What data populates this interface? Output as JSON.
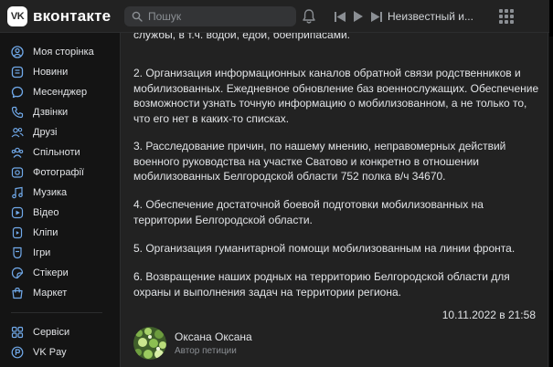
{
  "header": {
    "logo_badge": "VK",
    "logo_text": "вконтакте",
    "search_placeholder": "Пошук",
    "track_title": "Неизвестный и..."
  },
  "sidebar": {
    "items": [
      {
        "label": "Моя сторінка",
        "icon": "profile-icon"
      },
      {
        "label": "Новини",
        "icon": "news-icon"
      },
      {
        "label": "Месенджер",
        "icon": "messenger-icon"
      },
      {
        "label": "Дзвінки",
        "icon": "phone-icon"
      },
      {
        "label": "Друзі",
        "icon": "friends-icon"
      },
      {
        "label": "Спільноти",
        "icon": "communities-icon"
      },
      {
        "label": "Фотографії",
        "icon": "photos-icon"
      },
      {
        "label": "Музика",
        "icon": "music-icon"
      },
      {
        "label": "Відео",
        "icon": "video-icon"
      },
      {
        "label": "Кліпи",
        "icon": "clips-icon"
      },
      {
        "label": "Ігри",
        "icon": "games-icon"
      },
      {
        "label": "Стікери",
        "icon": "stickers-icon"
      },
      {
        "label": "Маркет",
        "icon": "market-icon"
      },
      {
        "label": "Сервіси",
        "icon": "services-icon"
      },
      {
        "label": "VK Pay",
        "icon": "vkpay-icon"
      }
    ]
  },
  "post": {
    "paragraphs": [
      "службы, в т.ч. водой, едой, боеприпасами.",
      "2. Организация информационных каналов обратной связи родственников и мобилизованных. Ежедневное обновление баз военнослужащих. Обеспечение возможности узнать точную информацию о мобилизованном, а не только то, что его нет в каких-то списках.",
      "3. Расследование причин, по нашему мнению, неправомерных действий военного руководства на участке Сватово и конкретно в отношении мобилизованных Белгородской области 752 полка в/ч 34670.",
      "4. Обеспечение достаточной боевой подготовки мобилизованных на территории Белгородской области.",
      "5. Организация гуманитарной помощи мобилизованным на линии фронта.",
      "6. Возвращение наших родных на территорию Белгородской области для охраны и выполнения задач на территории региона."
    ],
    "date": "10.11.2022 в 21:58",
    "author_name": "Оксана Оксана",
    "author_role": "Автор петиции"
  },
  "colors": {
    "background": "#141414",
    "panel": "#222222",
    "text": "#e1e3e6",
    "muted": "#8b8f94",
    "icon_accent": "#71aaeb"
  }
}
